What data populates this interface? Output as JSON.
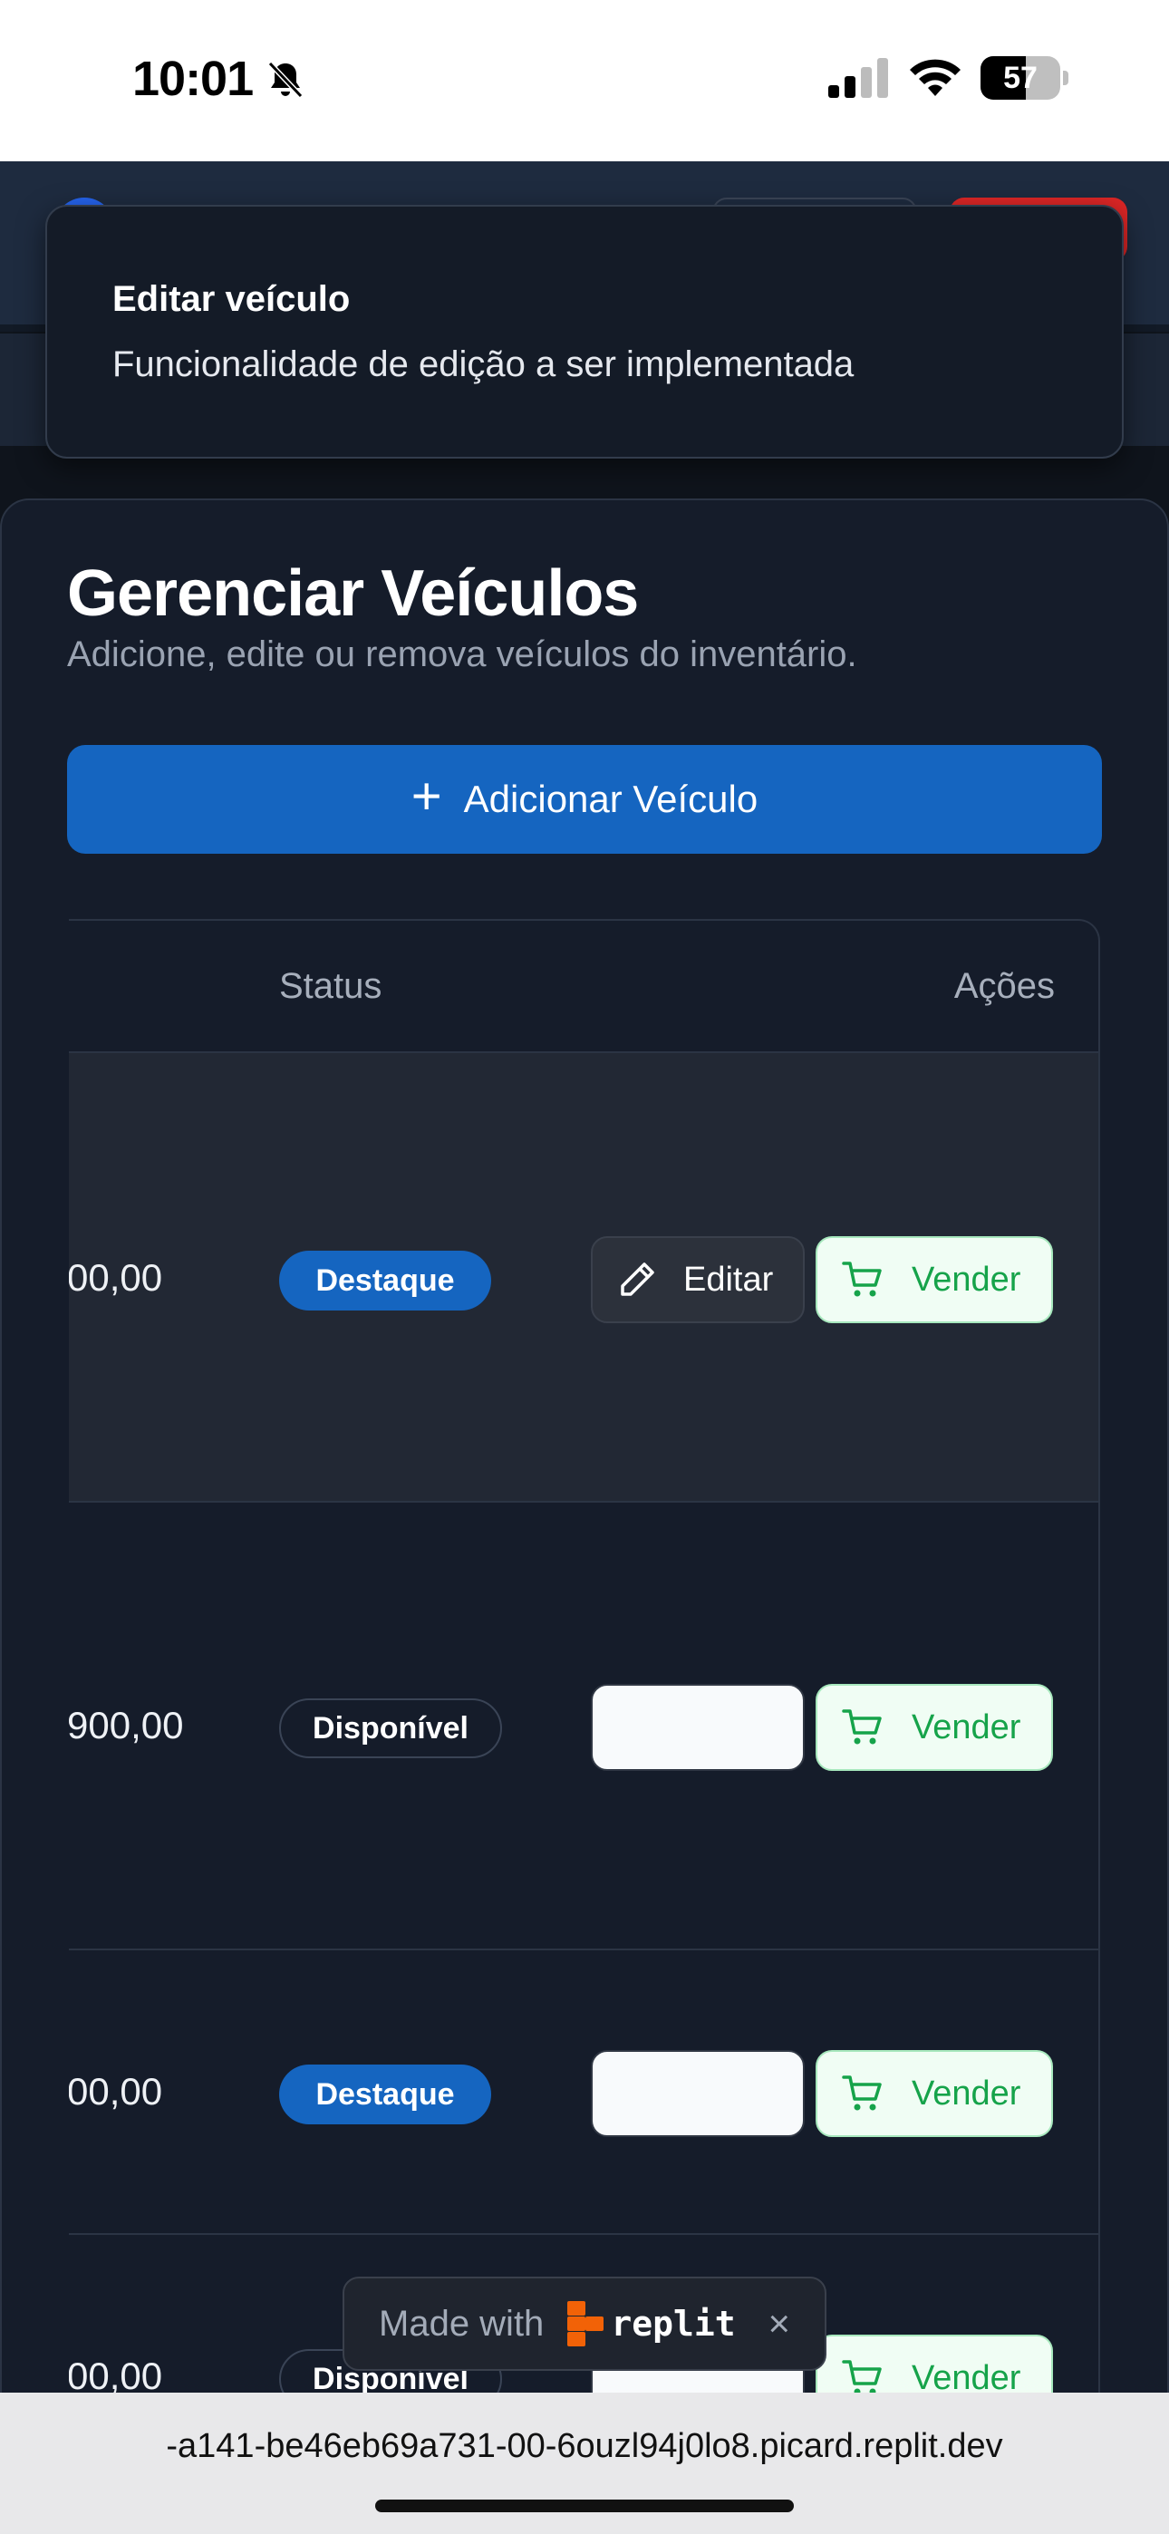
{
  "status_bar": {
    "time": "10:01",
    "battery": "57",
    "battery_level": 0.57
  },
  "toast": {
    "title": "Editar veículo",
    "description": "Funcionalidade de edição a ser implementada"
  },
  "page": {
    "title": "Gerenciar Veículos",
    "subtitle": "Adicione, edite ou remova veículos do inventário.",
    "add_button": "Adicionar Veículo"
  },
  "table": {
    "headers": {
      "status": "Status",
      "actions": "Ações"
    },
    "rows": [
      {
        "price": "00,00",
        "status": "Destaque",
        "edit": "Editar",
        "sell": "Vender"
      },
      {
        "price": "900,00",
        "status": "Disponível",
        "edit": "",
        "sell": "Vender"
      },
      {
        "price": "00,00",
        "status": "Destaque",
        "edit": "",
        "sell": "Vender"
      },
      {
        "price": "00,00",
        "status": "Disponível",
        "edit": "",
        "sell": "Vender"
      }
    ]
  },
  "replit_badge": {
    "made_with": "Made with",
    "brand": "replit",
    "close": "×"
  },
  "browser": {
    "url": "-a141-be46eb69a731-00-6ouzl94j0lo8.picard.replit.dev"
  },
  "colors": {
    "accent": "#1565c0",
    "sell_green": "#16a34a",
    "background": "#151c2a"
  }
}
